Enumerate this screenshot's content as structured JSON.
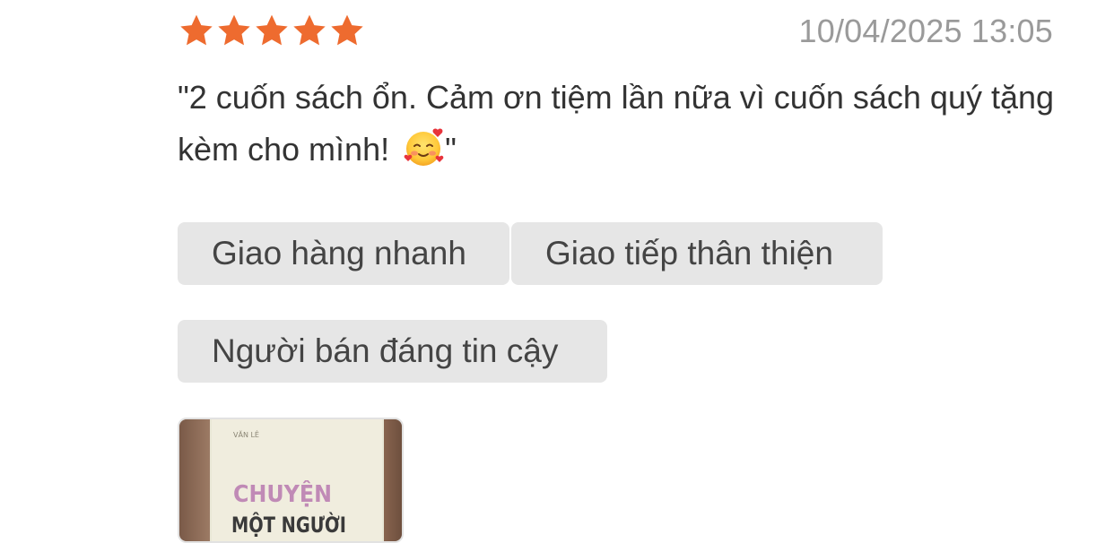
{
  "review": {
    "rating": 5,
    "rating_max": 5,
    "star_color": "#EE6B2F",
    "timestamp": "10/04/2025 13:05",
    "text_before_emoji": "\"2 cuốn sách ổn. Cảm ơn tiệm lần nữa vì cuốn sách quý tặng kèm cho mình! ",
    "text_after_emoji": "\"",
    "emoji": "smiling-face-with-hearts",
    "tags": [
      "Giao hàng nhanh",
      "Giao tiếp thân thiện",
      "Người bán đáng tin cậy"
    ],
    "photo": {
      "book_author": "VĂN LÊ",
      "book_title_line1": "CHUYỆN",
      "book_title_line2": "MỘT NGƯỜI"
    }
  }
}
